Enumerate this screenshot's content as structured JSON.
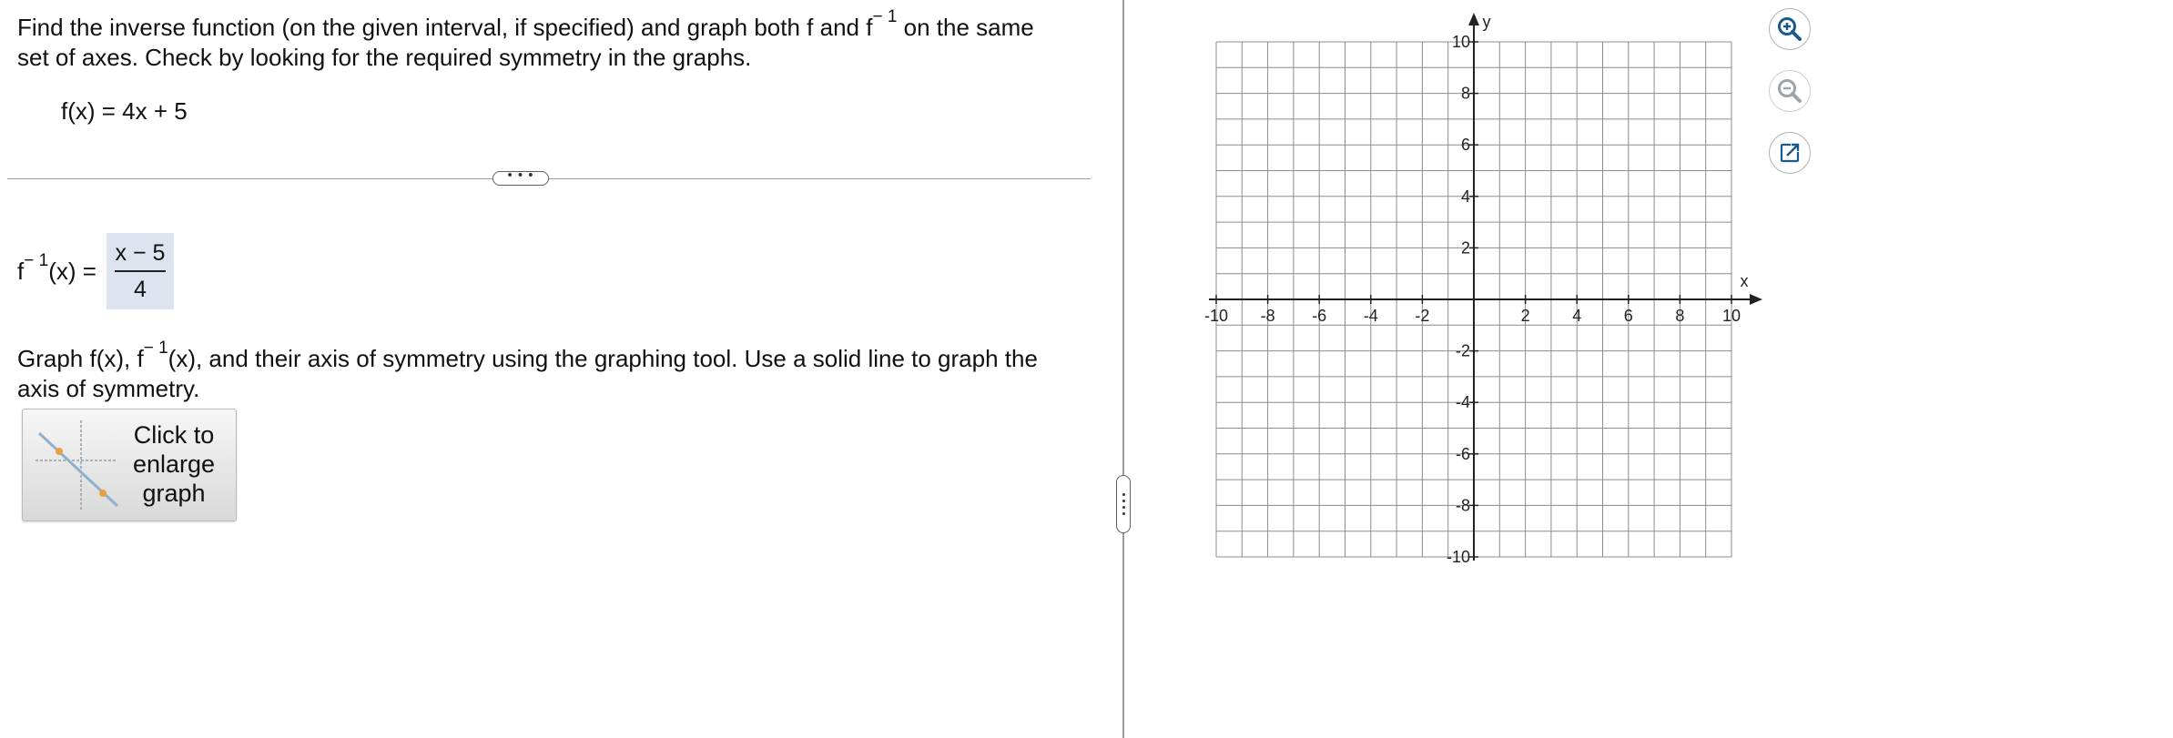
{
  "question": {
    "instruction_part1": "Find the inverse function (on the given interval, if specified) and graph both f and f",
    "exponent": "− 1",
    "instruction_part2": " on the same",
    "instruction_line2": "set of axes. Check by looking for the required symmetry in the graphs.",
    "function": "f(x) = 4x + 5"
  },
  "more_button": {
    "label": "• • •"
  },
  "answer": {
    "lhs_f": "f",
    "lhs_exp": "− 1",
    "lhs_rest": "(x) =",
    "numerator": "x − 5",
    "denominator": "4"
  },
  "graph_instruction": {
    "part1": "Graph f(x), f",
    "exp": "− 1",
    "part2": "(x), and their axis of symmetry using the graphing tool. Use a solid line to graph the",
    "line2": "axis of symmetry."
  },
  "enlarge_button": {
    "label": "Click to\nenlarge\ngraph"
  },
  "graph": {
    "x_axis_label": "x",
    "y_axis_label": "y",
    "x_ticks": [
      "-10",
      "-8",
      "-6",
      "-4",
      "-2",
      "2",
      "4",
      "6",
      "8",
      "10"
    ],
    "y_ticks": [
      "10",
      "8",
      "6",
      "4",
      "2",
      "-2",
      "-4",
      "-6",
      "-8",
      "-10"
    ],
    "xlim": [
      -10,
      10
    ],
    "ylim": [
      -10,
      10
    ],
    "grid": true,
    "grid_step": 1
  },
  "tools": [
    {
      "name": "zoom-in-icon",
      "color": "#1a5a8a"
    },
    {
      "name": "zoom-out-icon",
      "color": "#9aa4ad"
    },
    {
      "name": "popout-icon",
      "color": "#1a5a8a"
    }
  ]
}
